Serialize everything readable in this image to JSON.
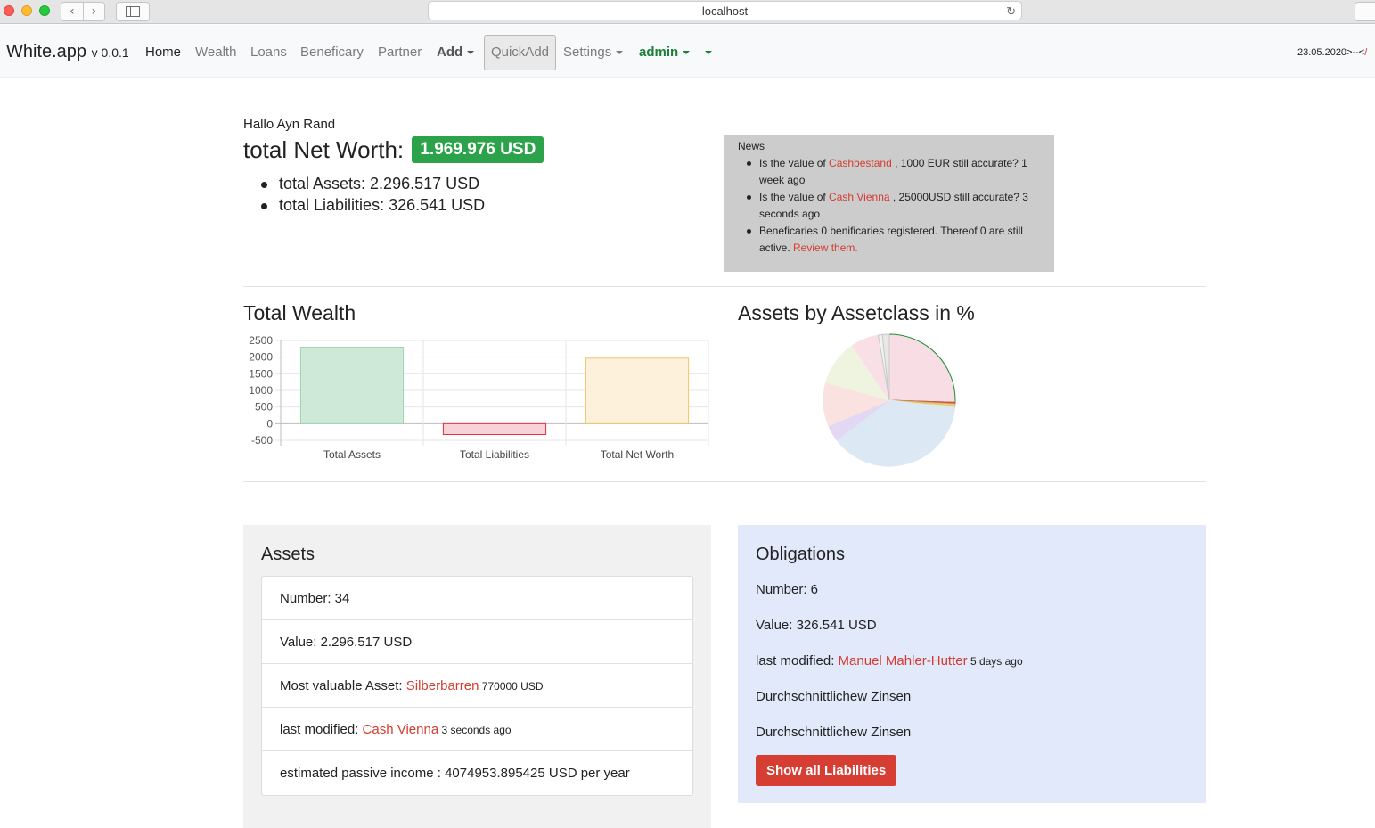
{
  "browser": {
    "url": "localhost"
  },
  "navbar": {
    "brand": "White.app",
    "version": "v 0.0.1",
    "items": [
      "Home",
      "Wealth",
      "Loans",
      "Beneficary",
      "Partner"
    ],
    "add_label": "Add",
    "quickadd_label": "QuickAdd",
    "settings_label": "Settings",
    "user_label": "admin",
    "date_text": "23.05.2020>--<",
    "date_text_red": "/"
  },
  "summary": {
    "greeting": "Hallo Ayn Rand",
    "networth_label": "total Net Worth:",
    "networth_value": "1.969.976 USD",
    "assets_text": "total Assets: 2.296.517 USD",
    "liabilities_text": "total Liabilities: 326.541 USD"
  },
  "news": {
    "title": "News",
    "item1_pre": "Is the value of ",
    "item1_link": "Cashbestand",
    "item1_post": " , 1000 EUR still accurate? 1 week ago",
    "item2_pre": "Is the value of ",
    "item2_link": "Cash Vienna",
    "item2_post": " , 25000USD still accurate? 3 seconds ago",
    "item3_pre": "Beneficaries 0 benificaries registered. Thereof 0 are still active. ",
    "item3_link": "Review them."
  },
  "charts": {
    "wealth_title": "Total Wealth",
    "pie_title": "Assets by Assetclass in %"
  },
  "chart_data": [
    {
      "type": "bar",
      "categories": [
        "Total Assets",
        "Total Liabilities",
        "Total Net Worth"
      ],
      "values": [
        2297,
        -327,
        1970
      ],
      "colors": [
        "#cfe9d9",
        "#f9d2d9",
        "#fdf1dc"
      ],
      "border_colors": [
        "#9fd3b3",
        "#d9333f",
        "#f0c66a"
      ],
      "ylim": [
        -500,
        2500
      ],
      "yticks": [
        -500,
        0,
        500,
        1000,
        1500,
        2000,
        2500
      ]
    },
    {
      "type": "pie",
      "values": [
        25.5,
        0.4,
        0.4,
        0.6,
        37.8,
        3.9,
        10.7,
        11.2,
        6.8,
        1.0,
        1.7
      ],
      "colors": [
        "#f8dee4",
        "#d05a3a",
        "#f6d8b5",
        "#efeab7",
        "#dde8f5",
        "#e2d8f4",
        "#f9e2df",
        "#eef4e0",
        "#f8e0e6",
        "#f2f2f2",
        "#e8e8e8"
      ],
      "border_colors": [
        "#1a8a3a",
        "#d05a3a",
        "#e0b070",
        "#d8c870",
        "#dde8f5",
        "#e2d8f4",
        "#f9e2df",
        "#eef4e0",
        "#f8e0e6",
        "#c8c8c8",
        "#c8c8c8"
      ]
    }
  ],
  "assets": {
    "title": "Assets",
    "number_text": "Number: 34",
    "value_text": "Value: 2.296.517 USD",
    "most_valuable_label": "Most valuable Asset: ",
    "most_valuable_link": "Silberbarren",
    "most_valuable_value": " 770000 USD",
    "last_modified_label": "last modified: ",
    "last_modified_link": "Cash Vienna",
    "last_modified_time": " 3 seconds ago",
    "passive_income_text": "estimated passive income : 4074953.895425 USD per year"
  },
  "obligations": {
    "title": "Obligations",
    "number_text": "Number: 6",
    "value_text": "Value: 326.541 USD",
    "last_modified_label": "last modified: ",
    "last_modified_link": "Manuel Mahler-Hutter",
    "last_modified_time": " 5 days ago",
    "interest_1": "Durchschnittlichew Zinsen",
    "interest_2": "Durchschnittlichew Zinsen",
    "button_label": "Show all Liabilities"
  }
}
